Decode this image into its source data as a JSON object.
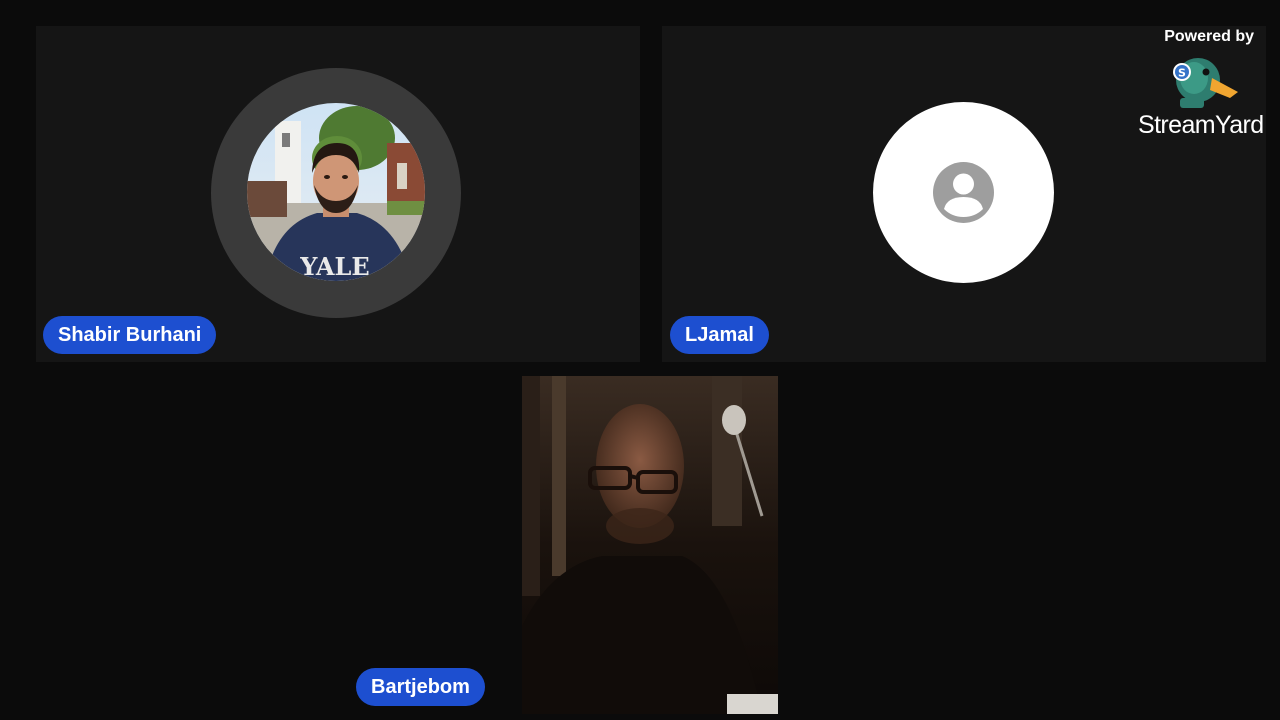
{
  "participants": [
    {
      "name": "Shabir Burhani",
      "avatar": "photo",
      "photo_text": "YALE"
    },
    {
      "name": "LJamal",
      "avatar": "person-placeholder-icon"
    },
    {
      "name": "Bartjebom",
      "avatar": "live-video"
    }
  ],
  "branding": {
    "powered_by": "Powered by",
    "brand_name": "StreamYard",
    "logo_icon": "duck-logo-icon"
  },
  "colors": {
    "background": "#0b0b0b",
    "tile": "#151515",
    "name_pill": "#1d4fd0",
    "name_text": "#ffffff"
  }
}
